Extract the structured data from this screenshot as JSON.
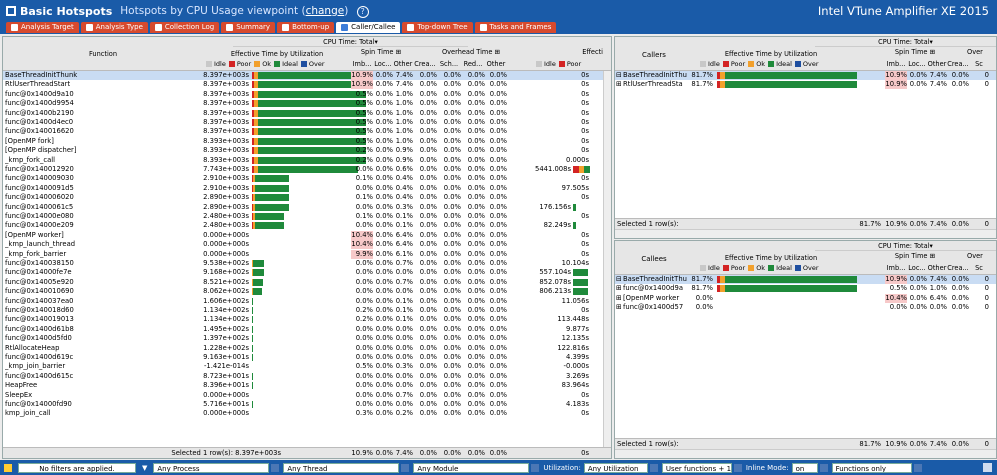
{
  "app": {
    "title": "Basic Hotspots",
    "subtitle_prefix": "Hotspots by CPU Usage viewpoint (",
    "subtitle_link": "change",
    "subtitle_suffix": ")",
    "product": "Intel VTune Amplifier XE 2015"
  },
  "tabs": [
    {
      "label": "Analysis Target",
      "icon": "target-icon"
    },
    {
      "label": "Analysis Type",
      "icon": "analysis-type-icon"
    },
    {
      "label": "Collection Log",
      "icon": "log-icon"
    },
    {
      "label": "Summary",
      "icon": "summary-icon"
    },
    {
      "label": "Bottom-up",
      "icon": "bottom-up-icon"
    },
    {
      "label": "Caller/Callee",
      "icon": "caller-callee-icon",
      "active": true
    },
    {
      "label": "Top-down Tree",
      "icon": "top-down-icon"
    },
    {
      "label": "Tasks and Frames",
      "icon": "tasks-icon"
    }
  ],
  "colors": {
    "idle": "#c8c8c8",
    "poor": "#d32323",
    "ok": "#f2a02c",
    "ideal": "#1f8a3b",
    "over": "#1f4fa0"
  },
  "legend": {
    "idle": "Idle",
    "poor": "Poor",
    "ok": "Ok",
    "ideal": "Ideal",
    "over": "Over"
  },
  "main": {
    "cpu_time_header": "CPU Time: Total",
    "col_function": "Function",
    "col_effective": "Effective Time by Utilization",
    "col_spin": "Spin Time",
    "col_overhead": "Overhead Time",
    "col_effective2": "Effecti",
    "sub_imb": "Imb...",
    "sub_loc": "Loc...",
    "sub_other": "Other",
    "sub_crea": "Crea...",
    "sub_sch": "Sch...",
    "sub_red": "Red...",
    "sub_other2": "Other",
    "footer_label": "Selected 1 row(s):",
    "footer_values": [
      "8.397e+003s",
      "10.9%",
      "0.0%",
      "7.4%",
      "0.0%",
      "0.0%",
      "0.0%",
      "0.0%",
      "0s"
    ],
    "rows": [
      {
        "name": "BaseThreadInitThunk",
        "eff": "8.397e+003s",
        "bar": [
          0,
          1.5,
          4,
          108,
          0
        ],
        "imb": "10.9%",
        "loc": "0.0%",
        "other": "7.4%",
        "crea": "0.0%",
        "sch": "0.0%",
        "red": "0.0%",
        "other2": "0.0%",
        "e2": "0s",
        "sel": true,
        "imbHi": true
      },
      {
        "name": "RtlUserThreadStart",
        "eff": "8.397e+003s",
        "bar": [
          0,
          1.5,
          4,
          108,
          0
        ],
        "imb": "10.9%",
        "loc": "0.0%",
        "other": "7.4%",
        "crea": "0.0%",
        "sch": "0.0%",
        "red": "0.0%",
        "other2": "0.0%",
        "e2": "0s",
        "imbHi": true
      },
      {
        "name": "func@0x1400d9a10",
        "eff": "8.397e+003s",
        "bar": [
          0,
          1.5,
          4,
          108,
          0
        ],
        "imb": "0.5%",
        "loc": "0.0%",
        "other": "1.0%",
        "crea": "0.0%",
        "sch": "0.0%",
        "red": "0.0%",
        "other2": "0.0%",
        "e2": "0s"
      },
      {
        "name": "func@0x1400d9954",
        "eff": "8.397e+003s",
        "bar": [
          0,
          1.5,
          4,
          108,
          0
        ],
        "imb": "0.5%",
        "loc": "0.0%",
        "other": "1.0%",
        "crea": "0.0%",
        "sch": "0.0%",
        "red": "0.0%",
        "other2": "0.0%",
        "e2": "0s"
      },
      {
        "name": "func@0x1400b2190",
        "eff": "8.397e+003s",
        "bar": [
          0,
          1.5,
          4,
          108,
          0
        ],
        "imb": "0.5%",
        "loc": "0.0%",
        "other": "1.0%",
        "crea": "0.0%",
        "sch": "0.0%",
        "red": "0.0%",
        "other2": "0.0%",
        "e2": "0s"
      },
      {
        "name": "func@0x1400d4ec0",
        "eff": "8.397e+003s",
        "bar": [
          0,
          1.5,
          4,
          108,
          0
        ],
        "imb": "0.5%",
        "loc": "0.0%",
        "other": "1.0%",
        "crea": "0.0%",
        "sch": "0.0%",
        "red": "0.0%",
        "other2": "0.0%",
        "e2": "0s"
      },
      {
        "name": "func@0x140016620",
        "eff": "8.397e+003s",
        "bar": [
          0,
          1.5,
          4,
          108,
          0
        ],
        "imb": "0.5%",
        "loc": "0.0%",
        "other": "1.0%",
        "crea": "0.0%",
        "sch": "0.0%",
        "red": "0.0%",
        "other2": "0.0%",
        "e2": "0s"
      },
      {
        "name": "[OpenMP fork]",
        "eff": "8.393e+003s",
        "bar": [
          0,
          1.5,
          4,
          108,
          0
        ],
        "imb": "0.5%",
        "loc": "0.0%",
        "other": "1.0%",
        "crea": "0.0%",
        "sch": "0.0%",
        "red": "0.0%",
        "other2": "0.0%",
        "e2": "0s"
      },
      {
        "name": "[OpenMP dispatcher]",
        "eff": "8.393e+003s",
        "bar": [
          0,
          1.5,
          4,
          108,
          0
        ],
        "imb": "0.2%",
        "loc": "0.0%",
        "other": "0.9%",
        "crea": "0.0%",
        "sch": "0.0%",
        "red": "0.0%",
        "other2": "0.0%",
        "e2": "0s"
      },
      {
        "name": "_kmp_fork_call",
        "eff": "8.393e+003s",
        "bar": [
          0,
          1.5,
          4,
          108,
          0
        ],
        "imb": "0.2%",
        "loc": "0.0%",
        "other": "0.9%",
        "crea": "0.0%",
        "sch": "0.0%",
        "red": "0.0%",
        "other2": "0.0%",
        "e2": "0.000s"
      },
      {
        "name": "func@0x140012920",
        "eff": "7.743e+003s",
        "bar": [
          0,
          1.5,
          4,
          100,
          0
        ],
        "imb": "0.0%",
        "loc": "0.0%",
        "other": "0.6%",
        "crea": "0.0%",
        "sch": "0.0%",
        "red": "0.0%",
        "other2": "0.0%",
        "e2": "5441.008s",
        "e2bar": true
      },
      {
        "name": "func@0x140009030",
        "eff": "2.910e+003s",
        "bar": [
          0,
          1.2,
          2,
          34,
          0
        ],
        "imb": "0.1%",
        "loc": "0.0%",
        "other": "0.4%",
        "crea": "0.0%",
        "sch": "0.0%",
        "red": "0.0%",
        "other2": "0.0%",
        "e2": "0s"
      },
      {
        "name": "func@0x1400091d5",
        "eff": "2.910e+003s",
        "bar": [
          0,
          1.2,
          2,
          34,
          0
        ],
        "imb": "0.0%",
        "loc": "0.0%",
        "other": "0.4%",
        "crea": "0.0%",
        "sch": "0.0%",
        "red": "0.0%",
        "other2": "0.0%",
        "e2": "97.505s"
      },
      {
        "name": "func@0x140006020",
        "eff": "2.890e+003s",
        "bar": [
          0,
          1.2,
          2,
          34,
          0
        ],
        "imb": "0.1%",
        "loc": "0.0%",
        "other": "0.4%",
        "crea": "0.0%",
        "sch": "0.0%",
        "red": "0.0%",
        "other2": "0.0%",
        "e2": "0s"
      },
      {
        "name": "func@0x1400061c5",
        "eff": "2.890e+003s",
        "bar": [
          0,
          1.2,
          2,
          34,
          0
        ],
        "imb": "0.0%",
        "loc": "0.0%",
        "other": "0.3%",
        "crea": "0.0%",
        "sch": "0.0%",
        "red": "0.0%",
        "other2": "0.0%",
        "e2": "176.156s",
        "e2small": true
      },
      {
        "name": "func@0x14000e080",
        "eff": "2.480e+003s",
        "bar": [
          0,
          1.2,
          2,
          29,
          0
        ],
        "imb": "0.1%",
        "loc": "0.0%",
        "other": "0.1%",
        "crea": "0.0%",
        "sch": "0.0%",
        "red": "0.0%",
        "other2": "0.0%",
        "e2": "0s"
      },
      {
        "name": "func@0x14000e209",
        "eff": "2.480e+003s",
        "bar": [
          0,
          1.2,
          2,
          29,
          0
        ],
        "imb": "0.0%",
        "loc": "0.0%",
        "other": "0.1%",
        "crea": "0.0%",
        "sch": "0.0%",
        "red": "0.0%",
        "other2": "0.0%",
        "e2": "82.249s",
        "e2small": true
      },
      {
        "name": "[OpenMP worker]",
        "eff": "0.000e+000s",
        "bar": [
          0,
          0,
          0,
          0,
          0
        ],
        "imb": "10.4%",
        "loc": "0.0%",
        "other": "6.4%",
        "crea": "0.0%",
        "sch": "0.0%",
        "red": "0.0%",
        "other2": "0.0%",
        "e2": "0s",
        "imbHi": true
      },
      {
        "name": "_kmp_launch_thread",
        "eff": "0.000e+000s",
        "bar": [
          0,
          0,
          0,
          0,
          0
        ],
        "imb": "10.4%",
        "loc": "0.0%",
        "other": "6.4%",
        "crea": "0.0%",
        "sch": "0.0%",
        "red": "0.0%",
        "other2": "0.0%",
        "e2": "0s",
        "imbHi": true
      },
      {
        "name": "_kmp_fork_barrier",
        "eff": "0.000e+000s",
        "bar": [
          0,
          0,
          0,
          0,
          0
        ],
        "imb": "9.9%",
        "loc": "0.0%",
        "other": "6.1%",
        "crea": "0.0%",
        "sch": "0.0%",
        "red": "0.0%",
        "other2": "0.0%",
        "e2": "0s",
        "imbHi": true
      },
      {
        "name": "func@0x140038150",
        "eff": "9.538e+002s",
        "bar": [
          0,
          0,
          1,
          11,
          0
        ],
        "imb": "0.0%",
        "loc": "0.0%",
        "other": "0.7%",
        "crea": "0.0%",
        "sch": "0.0%",
        "red": "0.0%",
        "other2": "0.0%",
        "e2": "10.104s"
      },
      {
        "name": "func@0x14000fe7e",
        "eff": "9.168e+002s",
        "bar": [
          0,
          0,
          1,
          11,
          0
        ],
        "imb": "0.0%",
        "loc": "0.0%",
        "other": "0.0%",
        "crea": "0.0%",
        "sch": "0.0%",
        "red": "0.0%",
        "other2": "0.0%",
        "e2": "557.104s",
        "e2bar2": true
      },
      {
        "name": "func@0x14005e920",
        "eff": "8.521e+002s",
        "bar": [
          0,
          0,
          1,
          10,
          0
        ],
        "imb": "0.0%",
        "loc": "0.0%",
        "other": "0.7%",
        "crea": "0.0%",
        "sch": "0.0%",
        "red": "0.0%",
        "other2": "0.0%",
        "e2": "852.078s",
        "e2bar2": true
      },
      {
        "name": "func@0x140010690",
        "eff": "8.062e+002s",
        "bar": [
          0,
          0,
          1,
          9,
          0
        ],
        "imb": "0.0%",
        "loc": "0.0%",
        "other": "0.0%",
        "crea": "0.0%",
        "sch": "0.0%",
        "red": "0.0%",
        "other2": "0.0%",
        "e2": "806.213s",
        "e2bar2": true
      },
      {
        "name": "func@0x140037ea0",
        "eff": "1.606e+002s",
        "bar": [
          0,
          0,
          0,
          1,
          0
        ],
        "imb": "0.0%",
        "loc": "0.0%",
        "other": "0.1%",
        "crea": "0.0%",
        "sch": "0.0%",
        "red": "0.0%",
        "other2": "0.0%",
        "e2": "11.056s"
      },
      {
        "name": "func@0x140018d60",
        "eff": "1.134e+002s",
        "bar": [
          0,
          0,
          0,
          1,
          0
        ],
        "imb": "0.2%",
        "loc": "0.0%",
        "other": "0.1%",
        "crea": "0.0%",
        "sch": "0.0%",
        "red": "0.0%",
        "other2": "0.0%",
        "e2": "0s"
      },
      {
        "name": "func@0x140019013",
        "eff": "1.134e+002s",
        "bar": [
          0,
          0,
          0,
          1,
          0
        ],
        "imb": "0.2%",
        "loc": "0.0%",
        "other": "0.1%",
        "crea": "0.0%",
        "sch": "0.0%",
        "red": "0.0%",
        "other2": "0.0%",
        "e2": "113.448s"
      },
      {
        "name": "func@0x1400d61b8",
        "eff": "1.495e+002s",
        "bar": [
          0,
          0,
          0,
          1,
          0
        ],
        "imb": "0.0%",
        "loc": "0.0%",
        "other": "0.0%",
        "crea": "0.0%",
        "sch": "0.0%",
        "red": "0.0%",
        "other2": "0.0%",
        "e2": "9.877s"
      },
      {
        "name": "func@0x1400d5fd0",
        "eff": "1.397e+002s",
        "bar": [
          0,
          0,
          0,
          1,
          0
        ],
        "imb": "0.0%",
        "loc": "0.0%",
        "other": "0.0%",
        "crea": "0.0%",
        "sch": "0.0%",
        "red": "0.0%",
        "other2": "0.0%",
        "e2": "12.135s"
      },
      {
        "name": "RtlAllocateHeap",
        "eff": "1.228e+002s",
        "bar": [
          0,
          0,
          0,
          1,
          0
        ],
        "imb": "0.0%",
        "loc": "0.0%",
        "other": "0.0%",
        "crea": "0.0%",
        "sch": "0.0%",
        "red": "0.0%",
        "other2": "0.0%",
        "e2": "122.816s"
      },
      {
        "name": "func@0x1400d619c",
        "eff": "9.163e+001s",
        "bar": [
          0,
          0,
          0,
          1,
          0
        ],
        "imb": "0.0%",
        "loc": "0.0%",
        "other": "0.0%",
        "crea": "0.0%",
        "sch": "0.0%",
        "red": "0.0%",
        "other2": "0.0%",
        "e2": "4.399s"
      },
      {
        "name": "_kmp_join_barrier",
        "eff": "-1.421e-014s",
        "bar": [
          0,
          0,
          0,
          0,
          0
        ],
        "imb": "0.5%",
        "loc": "0.0%",
        "other": "0.3%",
        "crea": "0.0%",
        "sch": "0.0%",
        "red": "0.0%",
        "other2": "0.0%",
        "e2": "-0.000s"
      },
      {
        "name": "func@0x1400d615c",
        "eff": "8.723e+001s",
        "bar": [
          0,
          0,
          0,
          1,
          0
        ],
        "imb": "0.0%",
        "loc": "0.0%",
        "other": "0.0%",
        "crea": "0.0%",
        "sch": "0.0%",
        "red": "0.0%",
        "other2": "0.0%",
        "e2": "3.269s"
      },
      {
        "name": "HeapFree",
        "eff": "8.396e+001s",
        "bar": [
          0,
          0,
          0,
          1,
          0
        ],
        "imb": "0.0%",
        "loc": "0.0%",
        "other": "0.0%",
        "crea": "0.0%",
        "sch": "0.0%",
        "red": "0.0%",
        "other2": "0.0%",
        "e2": "83.964s"
      },
      {
        "name": "SleepEx",
        "eff": "0.000e+000s",
        "bar": [
          0,
          0,
          0,
          0,
          0
        ],
        "imb": "0.0%",
        "loc": "0.0%",
        "other": "0.7%",
        "crea": "0.0%",
        "sch": "0.0%",
        "red": "0.0%",
        "other2": "0.0%",
        "e2": "0s"
      },
      {
        "name": "func@0x14000fd90",
        "eff": "5.716e+001s",
        "bar": [
          0,
          0,
          0,
          1,
          0
        ],
        "imb": "0.0%",
        "loc": "0.0%",
        "other": "0.0%",
        "crea": "0.0%",
        "sch": "0.0%",
        "red": "0.0%",
        "other2": "0.0%",
        "e2": "4.183s"
      },
      {
        "name": "kmp_join_call",
        "eff": "0.000e+000s",
        "bar": [
          0,
          0,
          0,
          0,
          0
        ],
        "imb": "0.3%",
        "loc": "0.0%",
        "other": "0.2%",
        "crea": "0.0%",
        "sch": "0.0%",
        "red": "0.0%",
        "other2": "0.0%",
        "e2": "0s"
      }
    ]
  },
  "callers": {
    "title": "Callers",
    "cpu_time_header": "CPU Time: Total",
    "col_effective": "Effective Time by Utilization",
    "col_spin": "Spin Time",
    "col_over": "Over",
    "sub_imb": "Imb...",
    "sub_loc": "Loc...",
    "sub_other": "Other",
    "sub_crea": "Crea...",
    "sub_sc": "Sc",
    "footer_label": "Selected 1 row(s):",
    "footer_values": [
      "81.7%",
      "10.9%",
      "0.0%",
      "7.4%",
      "0.0%",
      "0"
    ],
    "rows": [
      {
        "name": "BaseThreadInitThu",
        "pct": "81.7%",
        "bar": [
          0,
          3,
          5,
          132,
          0
        ],
        "imb": "10.9%",
        "loc": "0.0%",
        "other": "7.4%",
        "crea": "0.0%",
        "sc": "0",
        "sel": true,
        "imbHi": true,
        "exp": "⊟"
      },
      {
        "name": "RtlUserThreadSta",
        "pct": "81.7%",
        "bar": [
          0,
          3,
          5,
          132,
          0
        ],
        "imb": "10.9%",
        "loc": "0.0%",
        "other": "7.4%",
        "crea": "0.0%",
        "sc": "0",
        "imbHi": true,
        "exp": "⊞"
      }
    ]
  },
  "callees": {
    "title": "Callees",
    "cpu_time_header": "CPU Time: Total",
    "col_effective": "Effective Time by Utilization",
    "col_spin": "Spin Time",
    "col_over": "Over",
    "sub_imb": "Imb...",
    "sub_loc": "Loc...",
    "sub_other": "Other",
    "sub_crea": "Crea...",
    "sub_sc": "Sc",
    "footer_label": "Selected 1 row(s):",
    "footer_values": [
      "81.7%",
      "10.9%",
      "0.0%",
      "7.4%",
      "0.0%",
      "0"
    ],
    "rows": [
      {
        "name": "BaseThreadInitThu",
        "pct": "81.7%",
        "bar": [
          0,
          3,
          5,
          132,
          0
        ],
        "imb": "10.9%",
        "loc": "0.0%",
        "other": "7.4%",
        "crea": "0.0%",
        "sc": "0",
        "sel": true,
        "imbHi": true,
        "exp": "⊟"
      },
      {
        "name": "func@0x1400d9a",
        "pct": "81.7%",
        "bar": [
          0,
          3,
          5,
          132,
          0
        ],
        "imb": "0.5%",
        "loc": "0.0%",
        "other": "1.0%",
        "crea": "0.0%",
        "sc": "0",
        "exp": "⊞"
      },
      {
        "name": "[OpenMP worker",
        "pct": "0.0%",
        "bar": [
          0,
          0,
          0,
          0,
          0
        ],
        "imb": "10.4%",
        "loc": "0.0%",
        "other": "6.4%",
        "crea": "0.0%",
        "sc": "0",
        "imbHi": true,
        "exp": "⊞"
      },
      {
        "name": "func@0x1400d57",
        "pct": "0.0%",
        "bar": [
          0,
          0,
          0,
          0,
          0
        ],
        "imb": "0.0%",
        "loc": "0.0%",
        "other": "0.0%",
        "crea": "0.0%",
        "sc": "0",
        "exp": "⊞"
      }
    ]
  },
  "filters": {
    "status": "No filters are applied.",
    "process": "Any Process",
    "thread": "Any Thread",
    "module": "Any Module",
    "utilization_label": "Utilization:",
    "utilization": "Any Utilization",
    "user_functions": "User functions + 1",
    "inline_label": "Inline Mode:",
    "inline": "on",
    "functions_only": "Functions only"
  }
}
